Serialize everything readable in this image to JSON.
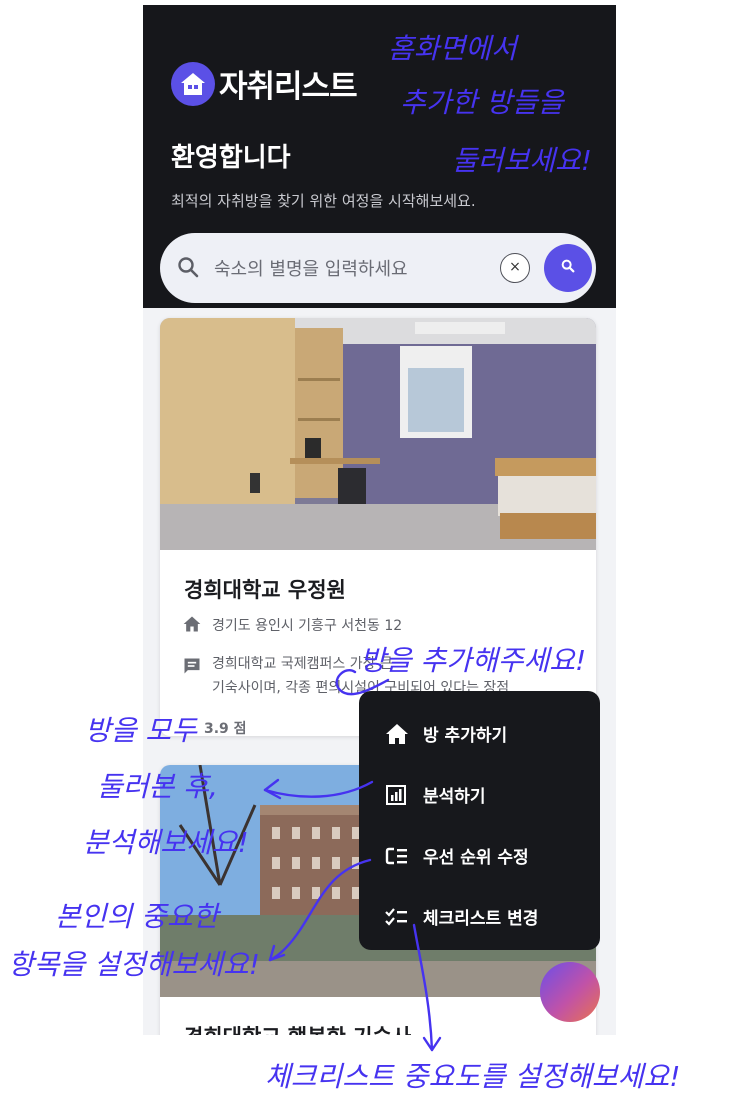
{
  "app": {
    "logo_text": "자취리스트"
  },
  "header": {
    "welcome": "환영합니다",
    "subtitle": "최적의 자취방을 찾기 위한 여정을 시작해보세요."
  },
  "search": {
    "placeholder": "숙소의 별명을 입력하세요",
    "clear_label": "×"
  },
  "cards": [
    {
      "title": "경희대학교 우정원",
      "address": "경기도 용인시 기흥구 서천동 12",
      "description_line1": "경희대학교 국제캠퍼스 가장 큰",
      "description_line2": "기숙사이며, 각종 편의시설이 구비되어 있다는 장점",
      "rating": "3.9 점"
    },
    {
      "title": "경희대학교 행복한 기숙사"
    }
  ],
  "menu": {
    "items": [
      {
        "label": "방 추가하기",
        "icon": "home-icon"
      },
      {
        "label": "분석하기",
        "icon": "analytics-icon"
      },
      {
        "label": "우선 순위 수정",
        "icon": "priority-icon"
      },
      {
        "label": "체크리스트 변경",
        "icon": "checklist-icon"
      }
    ]
  },
  "annotations": {
    "top_right_line1": "홈화면에서",
    "top_right_line2": "추가한 방들을",
    "top_right_line3": "둘러보세요!",
    "add_room": "방을 추가해주세요!",
    "analyze_line1": "방을 모두",
    "analyze_line2": "둘러본 후,",
    "analyze_line3": "분석해보세요!",
    "priority_line1": "본인의 중요한",
    "priority_line2": "항목을 설정해보세요!",
    "checklist": "체크리스트 중요도를 설정해보세요!"
  },
  "colors": {
    "accent": "#5b50e6",
    "header_bg": "#16171b",
    "annotation": "#4633f0"
  }
}
